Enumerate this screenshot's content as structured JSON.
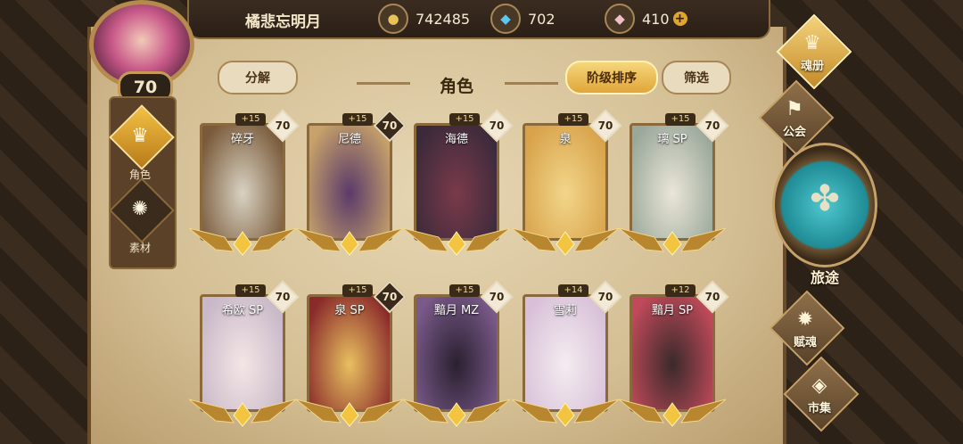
{
  "header": {
    "player_name": "橘悲忘明月",
    "level": "70",
    "currencies": [
      {
        "icon": "gold-coin-icon",
        "value": "742485"
      },
      {
        "icon": "blue-crystal-icon",
        "value": "702"
      },
      {
        "icon": "pink-gem-icon",
        "value": "410"
      }
    ],
    "plus_symbol": "+"
  },
  "sidebar": {
    "tabs": [
      {
        "label": "角色",
        "icon": "helmet-icon",
        "active": true
      },
      {
        "label": "素材",
        "icon": "beast-icon",
        "active": false
      }
    ]
  },
  "toolbar": {
    "decompose": "分解",
    "title": "角色",
    "sort": "阶级排序",
    "filter": "筛选"
  },
  "characters": [
    {
      "name": "碎牙",
      "plus": "+15",
      "level": "70",
      "lv_style": "light",
      "colors": [
        "#d8d2c2",
        "#7a5a3a"
      ]
    },
    {
      "name": "尼德",
      "plus": "+15",
      "level": "70",
      "lv_style": "dark",
      "colors": [
        "#5a3a6a",
        "#c7a26a"
      ]
    },
    {
      "name": "海德",
      "plus": "+15",
      "level": "70",
      "lv_style": "light",
      "colors": [
        "#7a3a4a",
        "#3a2a3a"
      ]
    },
    {
      "name": "泉",
      "plus": "+15",
      "level": "70",
      "lv_style": "light",
      "colors": [
        "#f2d68a",
        "#d8a24a"
      ]
    },
    {
      "name": "璃 SP",
      "plus": "+15",
      "level": "70",
      "lv_style": "light",
      "colors": [
        "#eae6d8",
        "#9aa89a"
      ]
    },
    {
      "name": "希欧 SP",
      "plus": "+15",
      "level": "70",
      "lv_style": "light",
      "colors": [
        "#f4e6e6",
        "#c8b8c8"
      ]
    },
    {
      "name": "泉 SP",
      "plus": "+15",
      "level": "70",
      "lv_style": "dark",
      "colors": [
        "#e8c060",
        "#8a2a2a"
      ]
    },
    {
      "name": "黯月 MZ",
      "plus": "+15",
      "level": "70",
      "lv_style": "light",
      "colors": [
        "#2a2030",
        "#7a5a8a"
      ]
    },
    {
      "name": "雪莉",
      "plus": "+14",
      "level": "70",
      "lv_style": "light",
      "colors": [
        "#f4ecf0",
        "#d8c0d8"
      ]
    },
    {
      "name": "黯月 SP",
      "plus": "+12",
      "level": "70",
      "lv_style": "light",
      "colors": [
        "#3a2a2a",
        "#c04a5a"
      ]
    }
  ],
  "right_nav": {
    "soul_book": "魂册",
    "guild": "公会",
    "journey": "旅途",
    "soul_gift": "赋魂",
    "market": "市集"
  }
}
